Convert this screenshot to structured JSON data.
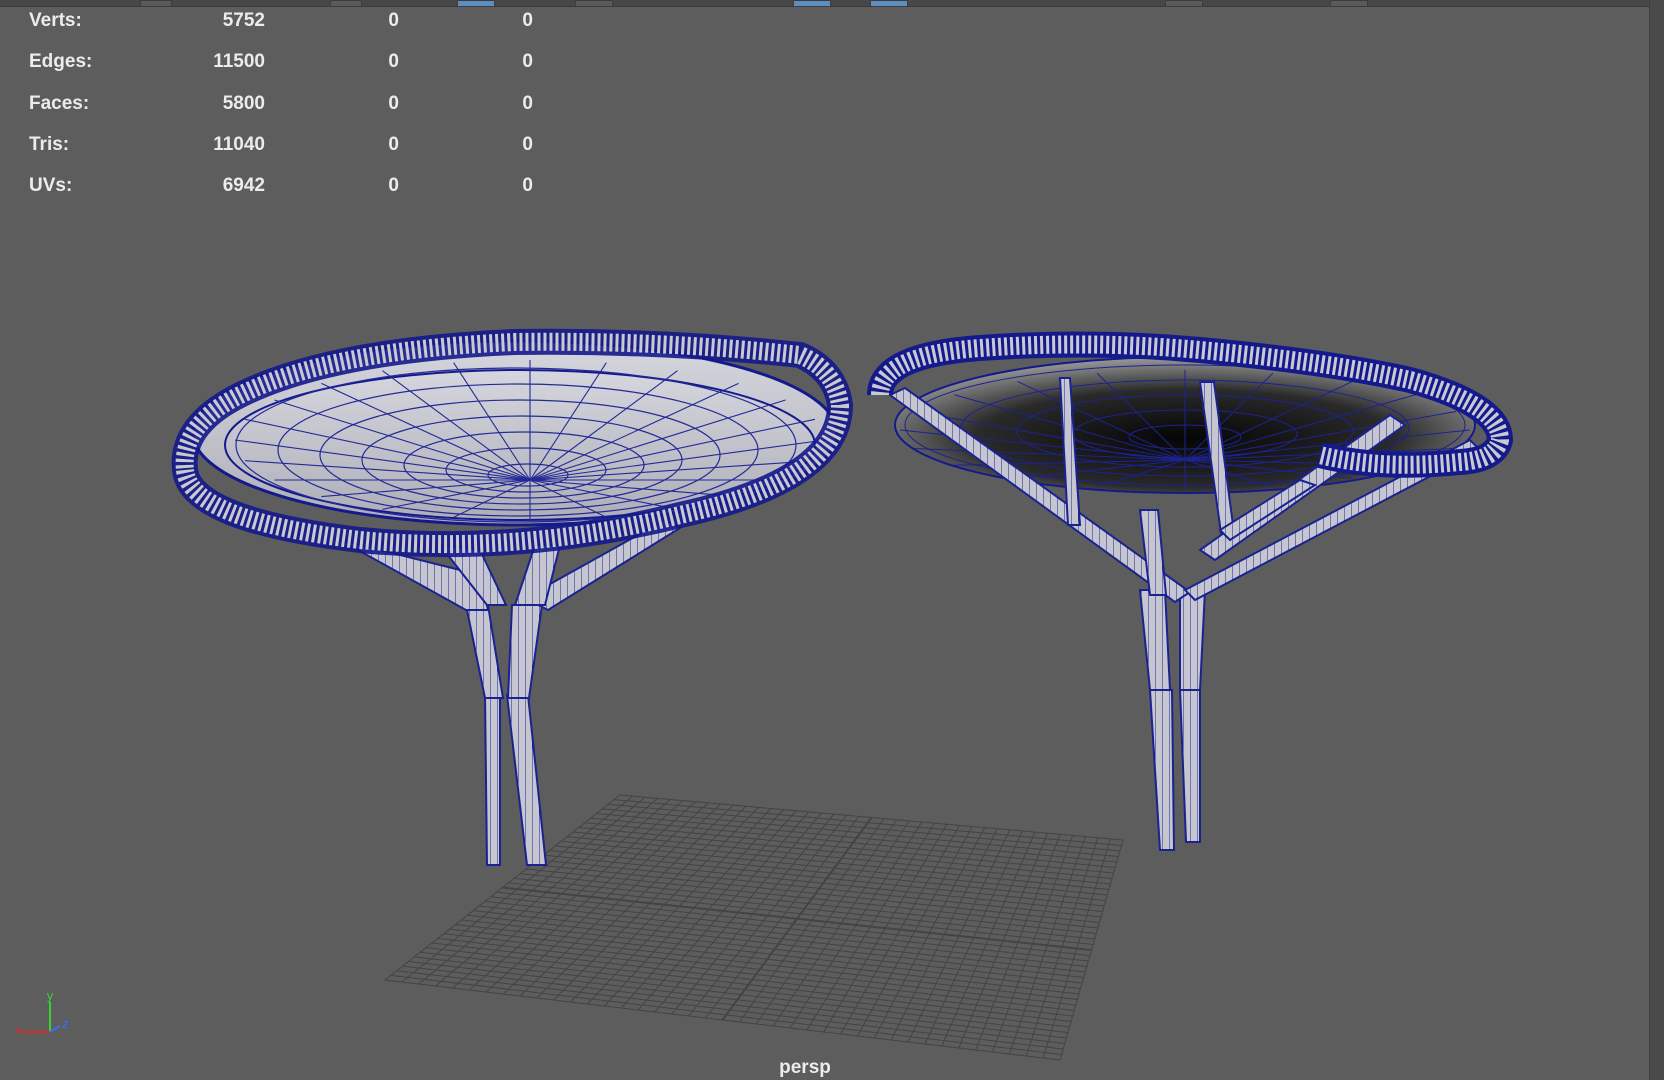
{
  "hud": {
    "rows": [
      {
        "label": "Verts:",
        "total": "5752",
        "selected": "0",
        "component": "0"
      },
      {
        "label": "Edges:",
        "total": "11500",
        "selected": "0",
        "component": "0"
      },
      {
        "label": "Faces:",
        "total": "5800",
        "selected": "0",
        "component": "0"
      },
      {
        "label": "Tris:",
        "total": "11040",
        "selected": "0",
        "component": "0"
      },
      {
        "label": "UVs:",
        "total": "6942",
        "selected": "0",
        "component": "0"
      }
    ]
  },
  "viewport": {
    "camera": "persp",
    "background": "#5d5d5d",
    "wire_color": "#141a8c",
    "mesh_color": "#c9c9d2",
    "grid_color": "#444444"
  },
  "axis_gizmo": {
    "x": "x",
    "y": "y",
    "z": "z"
  },
  "icons": [
    "axis-gizmo-icon"
  ]
}
